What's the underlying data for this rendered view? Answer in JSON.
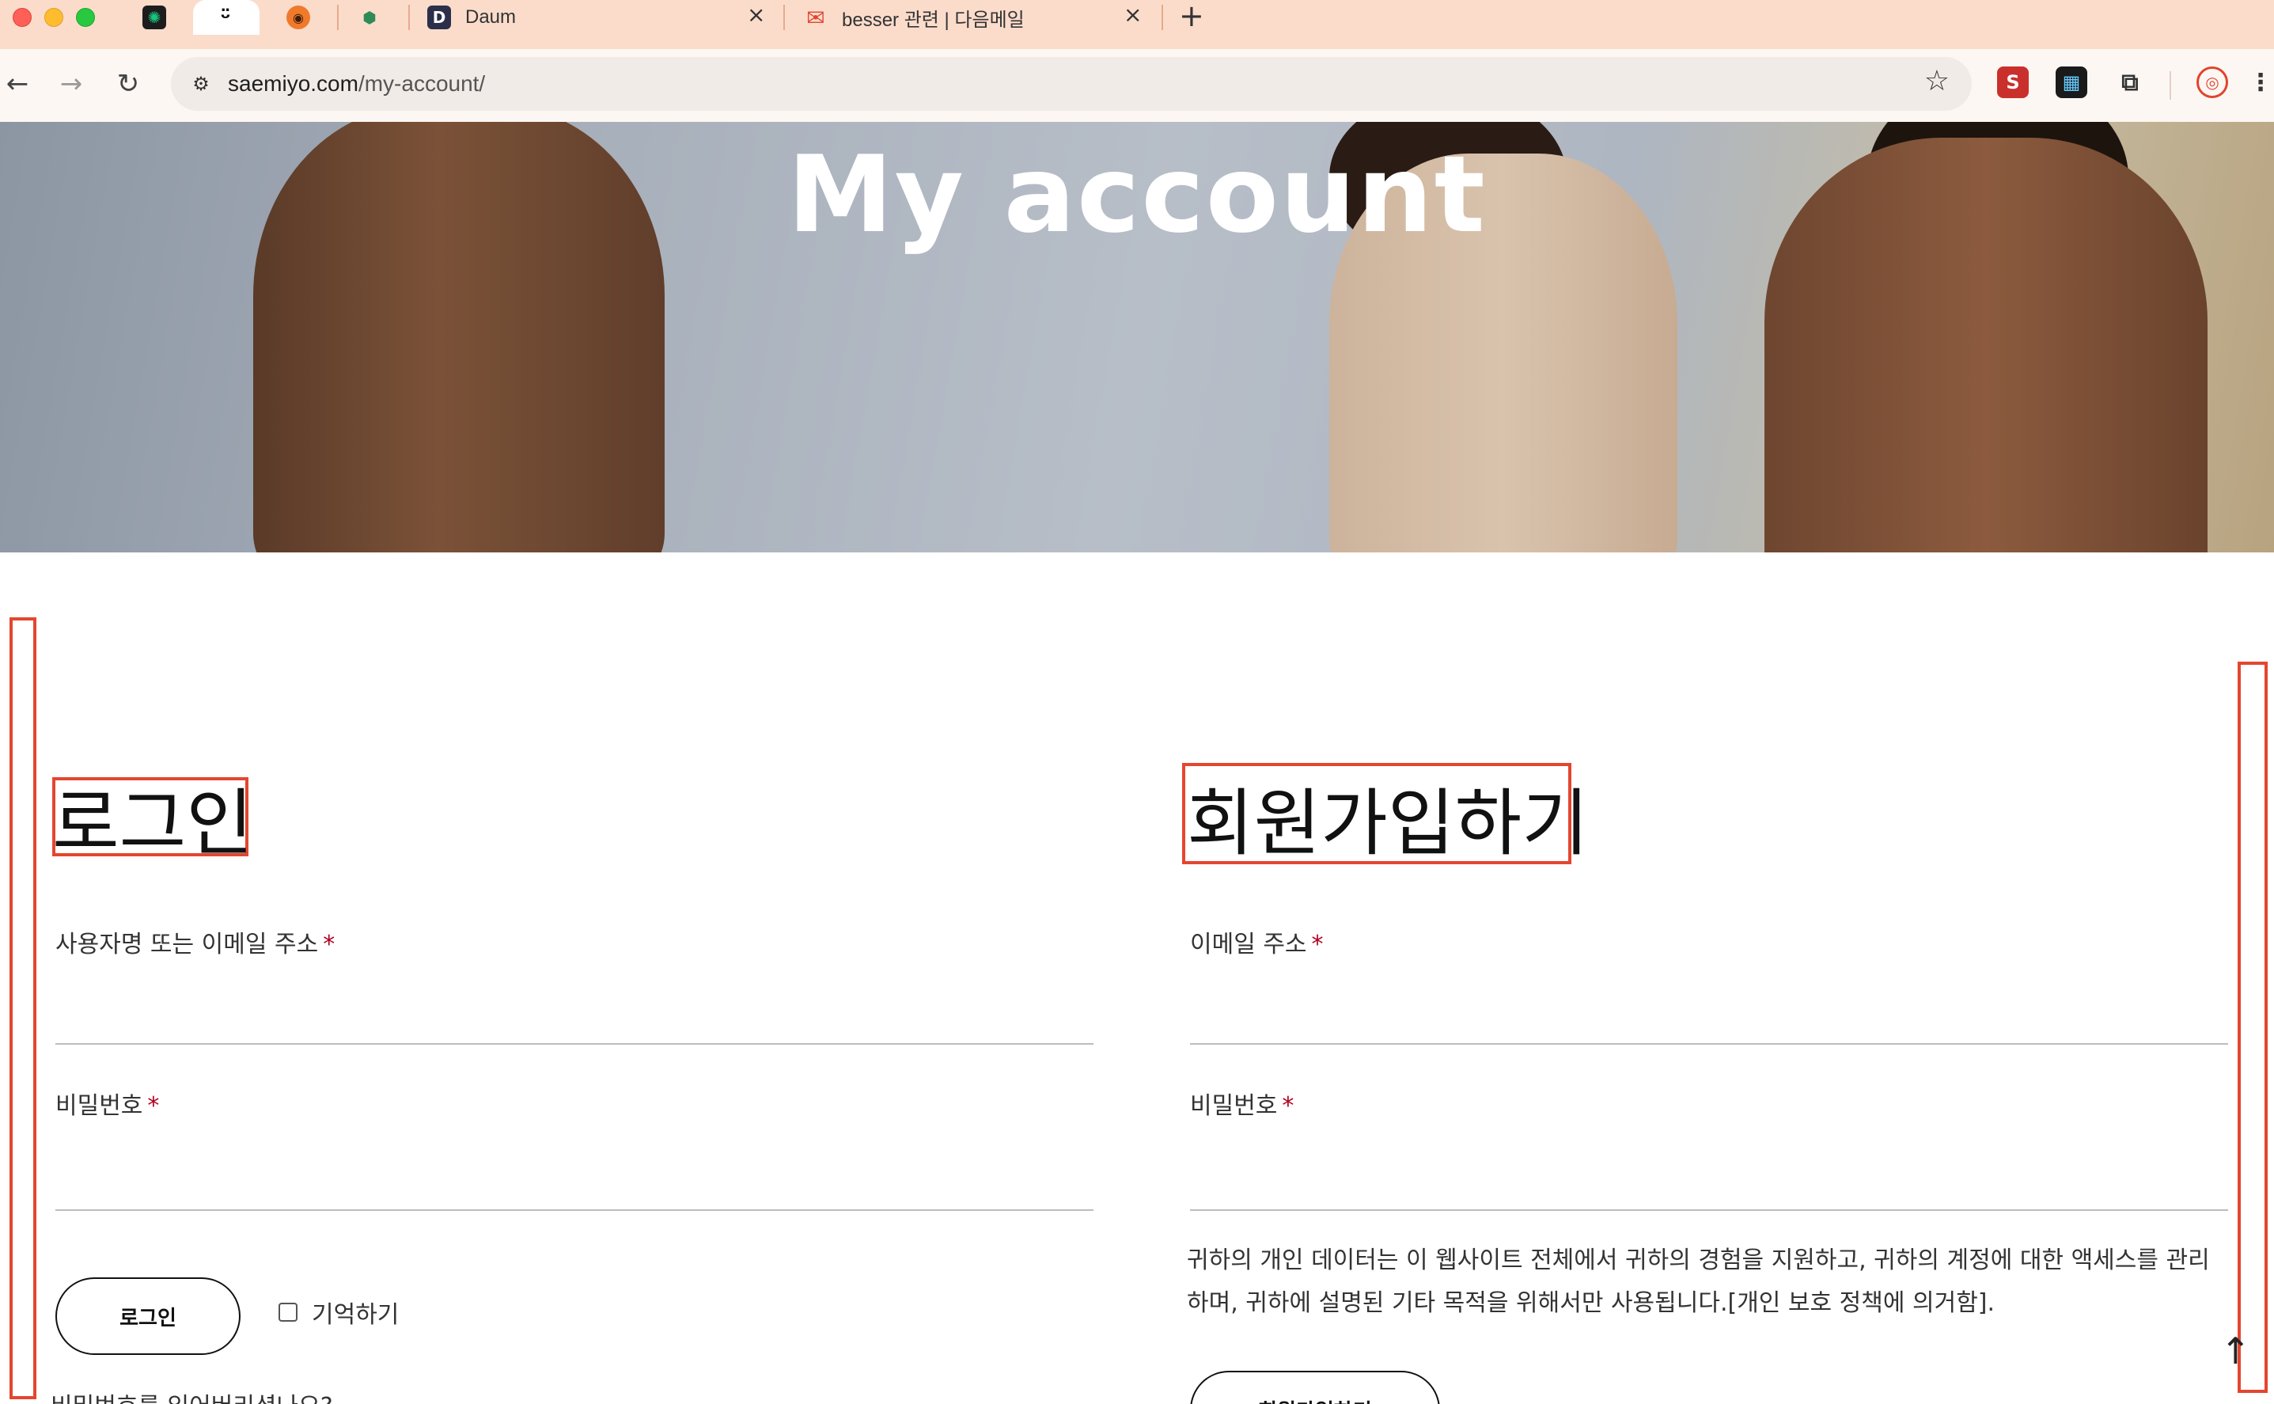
{
  "browser": {
    "tabs": [
      {
        "title": "",
        "icon": "chatgpt-icon"
      },
      {
        "title": "",
        "icon": "app-icon",
        "active": true
      },
      {
        "title": "",
        "icon": "pumpkin-icon"
      },
      {
        "title": "",
        "icon": "extension-puzzle-icon"
      },
      {
        "title": "Daum",
        "icon": "daum-icon"
      },
      {
        "title": "besser 관련 | 다음메일",
        "icon": "mail-icon"
      }
    ],
    "new_tab_symbol": "+",
    "close_symbol": "×",
    "url_host": "saemiyo.com",
    "url_path": "/my-account/",
    "ext_labels": {
      "s_ext": "S"
    }
  },
  "hero": {
    "title": "My account"
  },
  "login": {
    "title": "로그인",
    "username_label": "사용자명 또는 이메일 주소",
    "password_label": "비밀번호",
    "required_mark": "*",
    "submit_label": "로그인",
    "remember_label": "기억하기",
    "lost_password": "비밀번호를 잊어버리셨나요?"
  },
  "register": {
    "title": "회원가입하기",
    "email_label": "이메일 주소",
    "password_label": "비밀번호",
    "required_mark": "*",
    "privacy_text": "귀하의 개인 데이터는 이 웹사이트 전체에서 귀하의 경험을 지원하고, 귀하의 계정에 대한 액세스를 관리하며, 귀하에 설명된 기타 목적을 위해서만 사용됩니다.[개인 보호 정책에 의거함].",
    "submit_label": "회원가입하기"
  },
  "colors": {
    "tab_strip": "#fbdccb",
    "annotation": "#e4462f",
    "required": "#b00020"
  }
}
